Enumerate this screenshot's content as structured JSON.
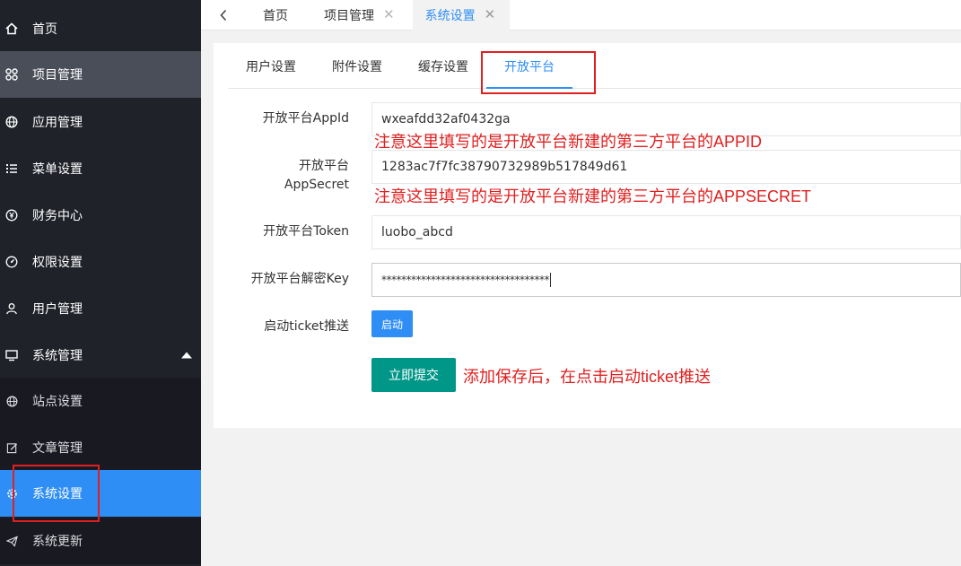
{
  "sidebar": {
    "items": [
      {
        "label": "首页",
        "icon": "home-icon"
      },
      {
        "label": "项目管理",
        "icon": "apps-icon"
      },
      {
        "label": "应用管理",
        "icon": "globe-icon"
      },
      {
        "label": "菜单设置",
        "icon": "list-icon"
      },
      {
        "label": "财务中心",
        "icon": "yen-icon"
      },
      {
        "label": "权限设置",
        "icon": "dial-icon"
      },
      {
        "label": "用户管理",
        "icon": "user-icon"
      },
      {
        "label": "系统管理",
        "icon": "monitor-icon"
      }
    ],
    "sub_items": [
      {
        "label": "站点设置",
        "icon": "globe-icon"
      },
      {
        "label": "文章管理",
        "icon": "edit-icon"
      },
      {
        "label": "系统设置",
        "icon": "gear-icon"
      },
      {
        "label": "系统更新",
        "icon": "send-icon"
      }
    ]
  },
  "topbar": {
    "tabs": [
      {
        "label": "首页"
      },
      {
        "label": "项目管理"
      },
      {
        "label": "系统设置"
      }
    ]
  },
  "subtabs": [
    "用户设置",
    "附件设置",
    "缓存设置",
    "开放平台"
  ],
  "form": {
    "appid_label": "开放平台AppId",
    "appid_value": "wxeafdd32af0432ga",
    "appid_note": "注意这里填写的是开放平台新建的第三方平台的APPID",
    "secret_label_1": "开放平台",
    "secret_label_2": "AppSecret",
    "secret_value": "1283ac7f7fc38790732989b517849d61",
    "secret_note": "注意这里填写的是开放平台新建的第三方平台的APPSECRET",
    "token_label": "开放平台Token",
    "token_value": "luobo_abcd",
    "key_label": "开放平台解密Key",
    "key_value": "**********************************",
    "ticket_label": "启动ticket推送",
    "start_button": "启动",
    "submit_button": "立即提交",
    "submit_note": "添加保存后，在点击启动ticket推送"
  },
  "colors": {
    "sidebar_bg": "#20222a",
    "active_blue": "#2f8ef5",
    "submit_green": "#009688",
    "annotation_red": "#e02020"
  }
}
